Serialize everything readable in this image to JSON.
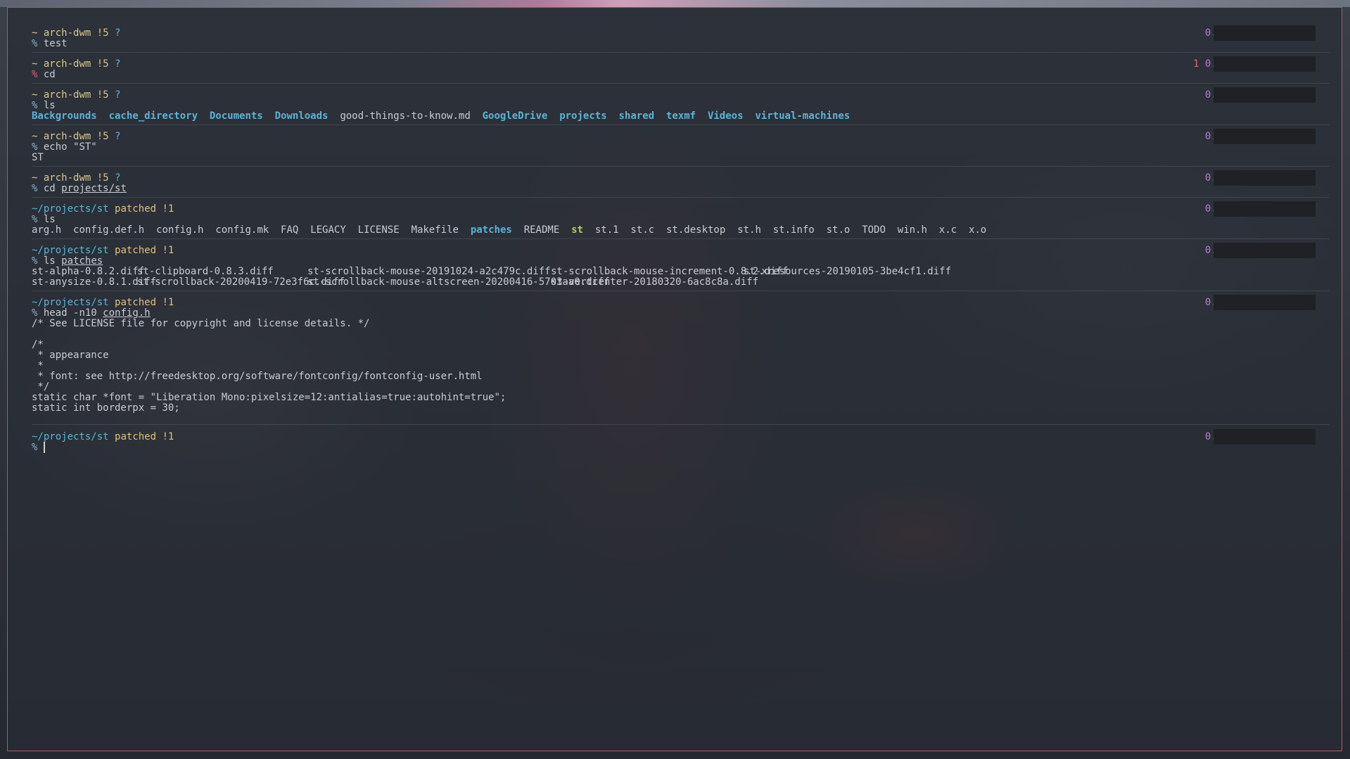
{
  "prompts": [
    {
      "kind": "home",
      "host": "arch-dwm",
      "dirty": "!5",
      "untracked": "?",
      "cmd": "test",
      "time": "0.01s",
      "status": ""
    },
    {
      "kind": "home",
      "host": "arch-dwm",
      "dirty": "!5",
      "untracked": "?",
      "cmd": "cd",
      "time": "0.01s",
      "status": "1"
    },
    {
      "kind": "home",
      "host": "arch-dwm",
      "dirty": "!5",
      "untracked": "?",
      "cmd": "ls",
      "time": "0.01s",
      "status": ""
    },
    {
      "kind": "home",
      "host": "arch-dwm",
      "dirty": "!5",
      "untracked": "?",
      "cmd": "echo \"ST\"",
      "time": "0.01s",
      "status": ""
    },
    {
      "kind": "home",
      "host": "arch-dwm",
      "dirty": "!5",
      "untracked": "?",
      "cmd": "cd ",
      "arg": "projects/st",
      "time": "0.01s",
      "status": ""
    },
    {
      "kind": "proj",
      "path": "~/projects/st",
      "branch": "patched",
      "dirty": "!1",
      "cmd": "ls",
      "time": "0.00s"
    },
    {
      "kind": "proj",
      "path": "~/projects/st",
      "branch": "patched",
      "dirty": "!1",
      "cmd": "ls ",
      "arg": "patches",
      "time": "0.01s"
    },
    {
      "kind": "proj",
      "path": "~/projects/st",
      "branch": "patched",
      "dirty": "!1",
      "cmd": "head -n10 ",
      "arg": "config.h",
      "time": "0.01s"
    },
    {
      "kind": "proj",
      "path": "~/projects/st",
      "branch": "patched",
      "dirty": "!1",
      "cmd": "",
      "time": "0.02s"
    }
  ],
  "symbols": {
    "tilde": "~",
    "percent": "%"
  },
  "ls_home": [
    {
      "name": "Backgrounds",
      "type": "dir"
    },
    {
      "name": "cache_directory",
      "type": "dir"
    },
    {
      "name": "Documents",
      "type": "dir"
    },
    {
      "name": "Downloads",
      "type": "dir"
    },
    {
      "name": "good-things-to-know.md",
      "type": "file"
    },
    {
      "name": "GoogleDrive",
      "type": "dir"
    },
    {
      "name": "projects",
      "type": "dir"
    },
    {
      "name": "shared",
      "type": "dir"
    },
    {
      "name": "texmf",
      "type": "dir"
    },
    {
      "name": "Videos",
      "type": "dir"
    },
    {
      "name": "virtual-machines",
      "type": "dir"
    }
  ],
  "echo_output": "ST",
  "ls_st": [
    {
      "name": "arg.h",
      "type": "file"
    },
    {
      "name": "config.def.h",
      "type": "file"
    },
    {
      "name": "config.h",
      "type": "file"
    },
    {
      "name": "config.mk",
      "type": "file"
    },
    {
      "name": "FAQ",
      "type": "file"
    },
    {
      "name": "LEGACY",
      "type": "file"
    },
    {
      "name": "LICENSE",
      "type": "file"
    },
    {
      "name": "Makefile",
      "type": "file"
    },
    {
      "name": "patches",
      "type": "dir"
    },
    {
      "name": "README",
      "type": "file"
    },
    {
      "name": "st",
      "type": "exe"
    },
    {
      "name": "st.1",
      "type": "file"
    },
    {
      "name": "st.c",
      "type": "file"
    },
    {
      "name": "st.desktop",
      "type": "file"
    },
    {
      "name": "st.h",
      "type": "file"
    },
    {
      "name": "st.info",
      "type": "file"
    },
    {
      "name": "st.o",
      "type": "file"
    },
    {
      "name": "TODO",
      "type": "file"
    },
    {
      "name": "win.h",
      "type": "file"
    },
    {
      "name": "x.c",
      "type": "file"
    },
    {
      "name": "x.o",
      "type": "file"
    }
  ],
  "ls_patches": {
    "row1": [
      "st-alpha-0.8.2.diff",
      "st-clipboard-0.8.3.diff",
      "st-scrollback-mouse-20191024-a2c479c.diff",
      "st-scrollback-mouse-increment-0.8.2.diff",
      "st-xresources-20190105-3be4cf1.diff"
    ],
    "row2": [
      "st-anysize-0.8.1.diff",
      "st-scrollback-20200419-72e3f6c.diff",
      "st-scrollback-mouse-altscreen-20200416-5703aa0.diff",
      "st-vertcenter-20180320-6ac8c8a.diff"
    ]
  },
  "head_output": [
    "/* See LICENSE file for copyright and license details. */",
    "",
    "/*",
    " * appearance",
    " *",
    " * font: see http://freedesktop.org/software/fontconfig/fontconfig-user.html",
    " */",
    "static char *font = \"Liberation Mono:pixelsize=12:antialias=true:autohint=true\";",
    "static int borderpx = 30;"
  ]
}
